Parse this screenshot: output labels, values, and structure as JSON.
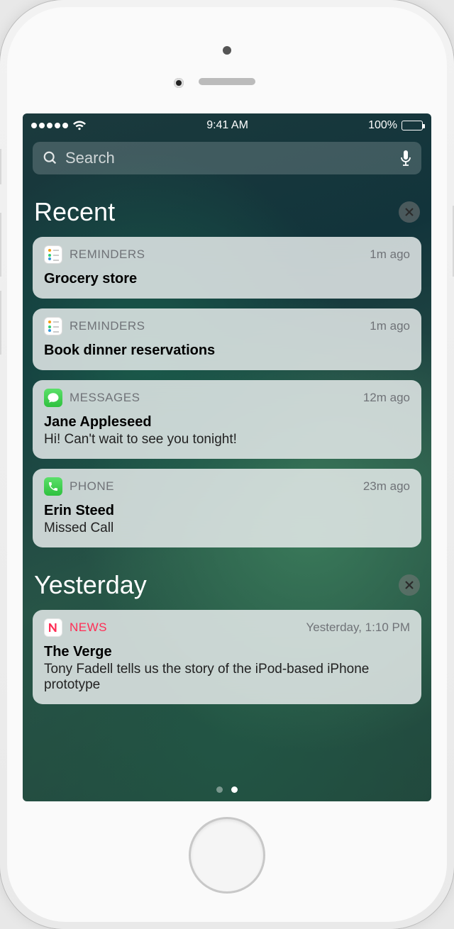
{
  "status": {
    "time": "9:41 AM",
    "battery_pct": "100%"
  },
  "search": {
    "placeholder": "Search"
  },
  "sections": {
    "recent": {
      "title": "Recent"
    },
    "yesterday": {
      "title": "Yesterday"
    }
  },
  "notifications": {
    "recent": [
      {
        "app": "REMINDERS",
        "time": "1m ago",
        "title": "Grocery store",
        "sub": ""
      },
      {
        "app": "REMINDERS",
        "time": "1m ago",
        "title": "Book dinner reservations",
        "sub": ""
      },
      {
        "app": "MESSAGES",
        "time": "12m ago",
        "title": "Jane Appleseed",
        "sub": "Hi! Can't wait to see you tonight!"
      },
      {
        "app": "PHONE",
        "time": "23m ago",
        "title": "Erin Steed",
        "sub": "Missed Call"
      }
    ],
    "yesterday": [
      {
        "app": "NEWS",
        "time": "Yesterday, 1:10 PM",
        "title": "The Verge",
        "sub": "Tony Fadell tells us the story of the iPod-based iPhone prototype"
      }
    ]
  }
}
